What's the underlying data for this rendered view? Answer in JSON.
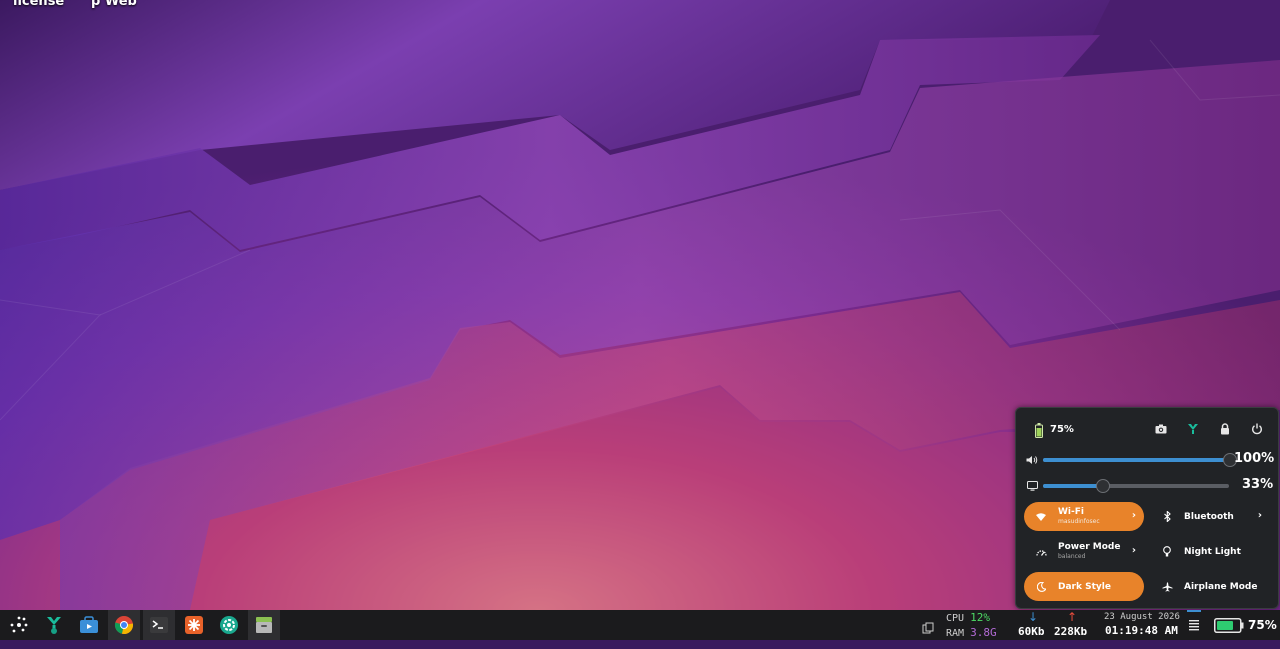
{
  "desktop": {
    "icons": [
      {
        "label": "license"
      },
      {
        "label": "p Web"
      }
    ]
  },
  "quick_settings": {
    "battery_pct": "75%",
    "volume": {
      "pct_label": "100%",
      "level": 1.0
    },
    "brightness": {
      "pct_label": "33%",
      "level": 0.33
    },
    "tiles": [
      {
        "label": "Wi-Fi",
        "sub": "masudinfosec",
        "on": true,
        "chevron": "›"
      },
      {
        "label": "Bluetooth",
        "sub": "",
        "on": false,
        "chevron": "›"
      },
      {
        "label": "Power Mode",
        "sub": "balanced",
        "on": false,
        "chevron": "›"
      },
      {
        "label": "Night Light",
        "sub": "",
        "on": false,
        "chevron": ""
      },
      {
        "label": "Dark Style",
        "sub": "",
        "on": true,
        "chevron": ""
      },
      {
        "label": "Airplane Mode",
        "sub": "",
        "on": false,
        "chevron": ""
      }
    ],
    "accent": "#e8832a",
    "slider_color": "#3d8fd1"
  },
  "taskbar": {
    "apps": [
      {
        "name": "app-launcher-icon"
      },
      {
        "name": "vpn-shield-icon"
      },
      {
        "name": "software-store-icon"
      },
      {
        "name": "chrome-icon"
      },
      {
        "name": "terminal-icon"
      },
      {
        "name": "burp-suite-icon"
      },
      {
        "name": "settings-app-icon"
      },
      {
        "name": "archive-manager-icon"
      }
    ],
    "tray": {
      "cpu_label": "CPU",
      "cpu_value": "12%",
      "ram_label": "RAM",
      "ram_value": "3.8G",
      "down_arrow": "↓",
      "down_speed": "60Kb",
      "up_arrow": "↑",
      "up_speed": "228Kb",
      "date": "23 August 2026",
      "time": "01:19:48 AM",
      "battery_pct": "75%"
    }
  }
}
